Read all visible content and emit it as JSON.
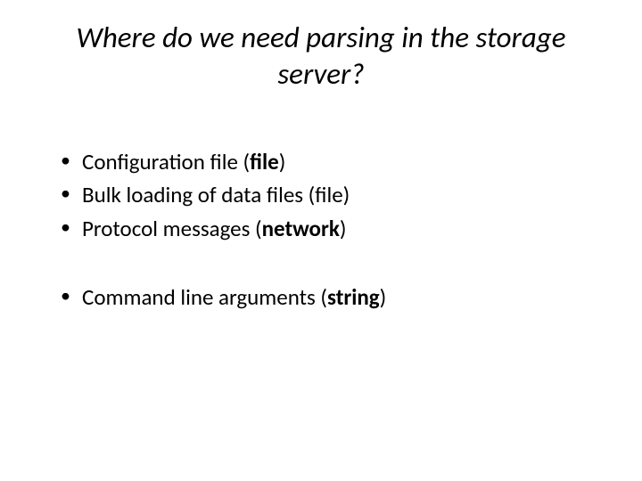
{
  "title": "Where do we need parsing in the storage server?",
  "group1": {
    "item1_pre": "Configuration file (",
    "item1_bold": "file",
    "item1_post": ")",
    "item2": "Bulk loading of data files (file)",
    "item3_pre": "Protocol messages (",
    "item3_bold": "network",
    "item3_post": ")"
  },
  "group2": {
    "item1_pre": "Command line arguments (",
    "item1_bold": "string",
    "item1_post": ")"
  }
}
